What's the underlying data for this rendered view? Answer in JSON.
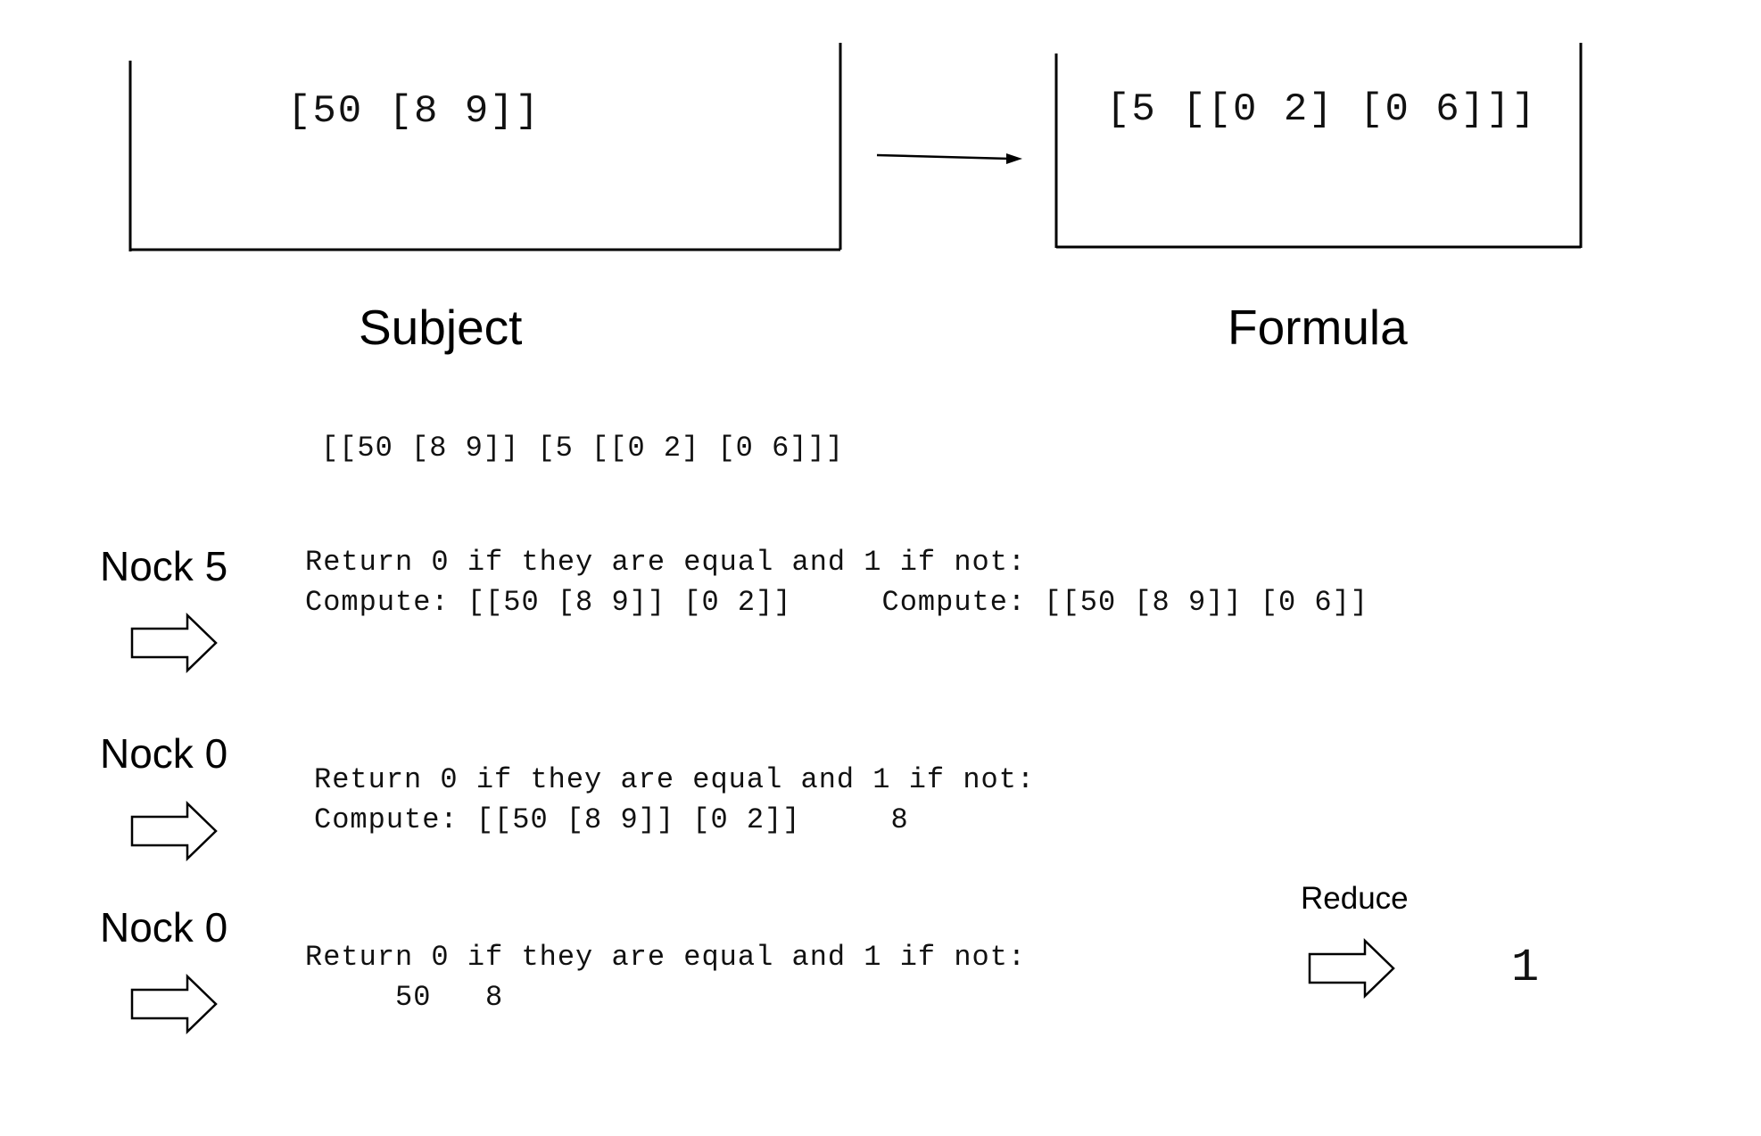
{
  "subject": {
    "value": "[50 [8 9]]",
    "caption": "Subject"
  },
  "formula": {
    "value": "[5 [[0 2] [0 6]]]",
    "caption": "Formula"
  },
  "combined": "[[50 [8 9]] [5 [[0 2] [0 6]]]",
  "steps": [
    {
      "label": "Nock 5",
      "line1": "Return 0 if they are equal and 1 if not:",
      "line2": "Compute: [[50 [8 9]] [0 2]]     Compute: [[50 [8 9]] [0 6]]",
      "icon": "right-arrow-icon"
    },
    {
      "label": "Nock 0",
      "line1": "Return 0 if they are equal and 1 if not:",
      "line2": "Compute: [[50 [8 9]] [0 2]]     8",
      "icon": "right-arrow-icon"
    },
    {
      "label": "Nock 0",
      "line1": "Return 0 if they are equal and 1 if not:",
      "line2": "     50   8",
      "icon": "right-arrow-icon"
    }
  ],
  "reduce": {
    "label": "Reduce",
    "result": "1",
    "icon": "right-arrow-icon"
  }
}
